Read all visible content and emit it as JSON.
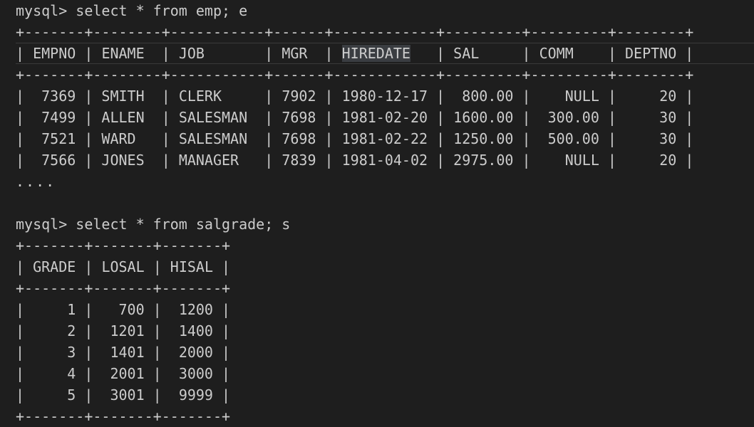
{
  "terminal": {
    "query1": {
      "prompt": "mysql>",
      "command": " select * from emp; e"
    },
    "emp_table": {
      "border": "+-------+--------+-----------+------+------------+---------+---------+--------+",
      "headers": {
        "empno": "EMPNO",
        "ename": "ENAME",
        "job": "JOB",
        "mgr": "MGR",
        "hiredate": "HIREDATE",
        "sal": "SAL",
        "comm": "COMM",
        "deptno": "DEPTNO"
      },
      "rows": [
        {
          "empno": "7369",
          "ename": "SMITH",
          "job": "CLERK",
          "mgr": "7902",
          "hiredate": "1980-12-17",
          "sal": "800.00",
          "comm": "NULL",
          "deptno": "20"
        },
        {
          "empno": "7499",
          "ename": "ALLEN",
          "job": "SALESMAN",
          "mgr": "7698",
          "hiredate": "1981-02-20",
          "sal": "1600.00",
          "comm": "300.00",
          "deptno": "30"
        },
        {
          "empno": "7521",
          "ename": "WARD",
          "job": "SALESMAN",
          "mgr": "7698",
          "hiredate": "1981-02-22",
          "sal": "1250.00",
          "comm": "500.00",
          "deptno": "30"
        },
        {
          "empno": "7566",
          "ename": "JONES",
          "job": "MANAGER",
          "mgr": "7839",
          "hiredate": "1981-04-02",
          "sal": "2975.00",
          "comm": "NULL",
          "deptno": "20"
        }
      ],
      "ellipsis": "...."
    },
    "query2": {
      "prompt": "mysql>",
      "command": " select * from salgrade; s"
    },
    "salgrade_table": {
      "border": "+-------+-------+-------+",
      "headers": {
        "grade": "GRADE",
        "losal": "LOSAL",
        "hisal": "HISAL"
      },
      "rows": [
        {
          "grade": "1",
          "losal": "700",
          "hisal": "1200"
        },
        {
          "grade": "2",
          "losal": "1201",
          "hisal": "1400"
        },
        {
          "grade": "3",
          "losal": "1401",
          "hisal": "2000"
        },
        {
          "grade": "4",
          "losal": "2001",
          "hisal": "3000"
        },
        {
          "grade": "5",
          "losal": "3001",
          "hisal": "9999"
        }
      ]
    }
  },
  "colors": {
    "background": "#1e1e1e",
    "text": "#cccccc",
    "selection_highlight": "#3a3d41"
  }
}
